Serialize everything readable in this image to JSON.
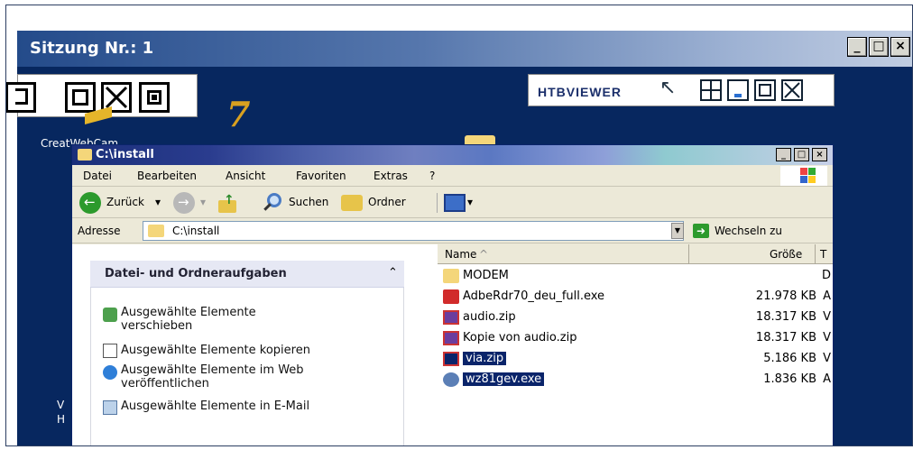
{
  "session": {
    "title": "Sitzung Nr.: 1",
    "controls": [
      "_",
      "□",
      "×"
    ]
  },
  "desktop": {
    "icon_label": "CreatWebCam",
    "left_letters": [
      "V",
      "H"
    ]
  },
  "htb": {
    "logo": "HTBVIEWER"
  },
  "explorer": {
    "title": "C:\\install",
    "menu": [
      "Datei",
      "Bearbeiten",
      "Ansicht",
      "Favoriten",
      "Extras",
      "?"
    ],
    "toolbar": {
      "back": "Zurück",
      "search": "Suchen",
      "folders": "Ordner"
    },
    "address": {
      "label": "Adresse",
      "value": "C:\\install",
      "go": "Wechseln zu"
    },
    "tasks": {
      "header": "Datei- und Ordneraufgaben",
      "items": [
        "Ausgewählte Elemente verschieben",
        "Ausgewählte Elemente kopieren",
        "Ausgewählte Elemente im Web veröffentlichen",
        "Ausgewählte Elemente in E-Mail"
      ]
    },
    "columns": {
      "name": "Name",
      "size": "Größe",
      "type": "T"
    },
    "files": [
      {
        "name": "MODEM",
        "size": "",
        "type": "D",
        "icon": "folder-icon",
        "selected": false
      },
      {
        "name": "AdbeRdr70_deu_full.exe",
        "size": "21.978 KB",
        "type": "A",
        "icon": "acrobat-icon",
        "selected": false
      },
      {
        "name": "audio.zip",
        "size": "18.317 KB",
        "type": "V",
        "icon": "zip-icon",
        "selected": false
      },
      {
        "name": "Kopie von audio.zip",
        "size": "18.317 KB",
        "type": "V",
        "icon": "zip-icon",
        "selected": false
      },
      {
        "name": "via.zip",
        "size": "5.186 KB",
        "type": "V",
        "icon": "zip-icon",
        "selected": true
      },
      {
        "name": "wz81gev.exe",
        "size": "1.836 KB",
        "type": "A",
        "icon": "exe-icon",
        "selected": true
      }
    ]
  },
  "colors": {
    "desktop": "#07275f",
    "selection": "#0a246a"
  }
}
